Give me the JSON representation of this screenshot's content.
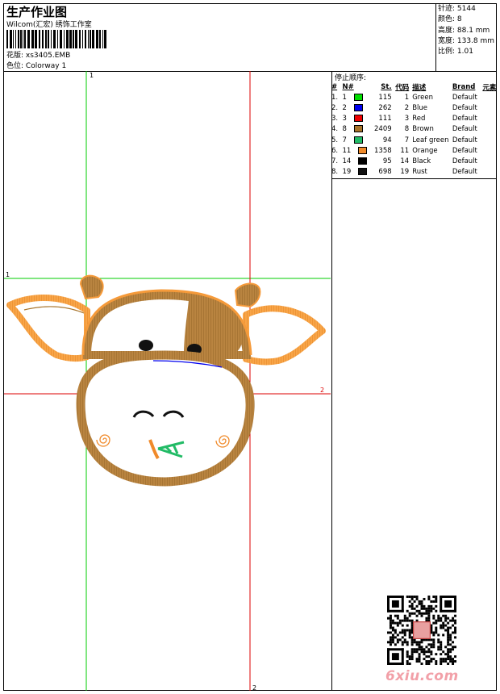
{
  "header": {
    "title": "生产作业图",
    "company": "Wilcom(汇宏) 绣饰工作室",
    "design_label": "花版:",
    "design_value": "xs3405.EMB",
    "colorway_label": "色位:",
    "colorway_value": "Colorway 1"
  },
  "stats": {
    "stitches": "针迹: 5144",
    "colors": "颜色: 8",
    "height": "高度: 88.1 mm",
    "width": "宽度: 133.8 mm",
    "scale": "比例: 1.01"
  },
  "stop_sequence": {
    "title": "停止顺序:",
    "headers": [
      "#",
      "N#",
      "St.",
      "代码",
      "描述",
      "Brand",
      "元素"
    ],
    "rows": [
      {
        "idx": "1.",
        "n": "1",
        "color": "#00dd00",
        "st": "115",
        "code": "1",
        "desc": "Green",
        "brand": "Default"
      },
      {
        "idx": "2.",
        "n": "2",
        "color": "#0000ee",
        "st": "262",
        "code": "2",
        "desc": "Blue",
        "brand": "Default"
      },
      {
        "idx": "3.",
        "n": "3",
        "color": "#ee0000",
        "st": "111",
        "code": "3",
        "desc": "Red",
        "brand": "Default"
      },
      {
        "idx": "4.",
        "n": "8",
        "color": "#a8742a",
        "st": "2409",
        "code": "8",
        "desc": "Brown",
        "brand": "Default"
      },
      {
        "idx": "5.",
        "n": "7",
        "color": "#22bb66",
        "st": "94",
        "code": "7",
        "desc": "Leaf green",
        "brand": "Default"
      },
      {
        "idx": "6.",
        "n": "11",
        "color": "#f08a2a",
        "st": "1358",
        "code": "11",
        "desc": "Orange",
        "brand": "Default"
      },
      {
        "idx": "7.",
        "n": "14",
        "color": "#000000",
        "st": "95",
        "code": "14",
        "desc": "Black",
        "brand": "Default"
      },
      {
        "idx": "8.",
        "n": "19",
        "color": "#111111",
        "st": "698",
        "code": "19",
        "desc": "Rust",
        "brand": "Default"
      }
    ]
  },
  "guides": {
    "v1_label": "1",
    "h1_label": "1",
    "h2_label": "2",
    "v2_label": "2"
  },
  "brand": {
    "text": "6xiu.com",
    "color": "#f2a0a8"
  },
  "colors": {
    "guide_green": "#00cc00",
    "guide_red": "#dd0000",
    "brown": "#a8742a",
    "orange": "#f59a3a"
  }
}
